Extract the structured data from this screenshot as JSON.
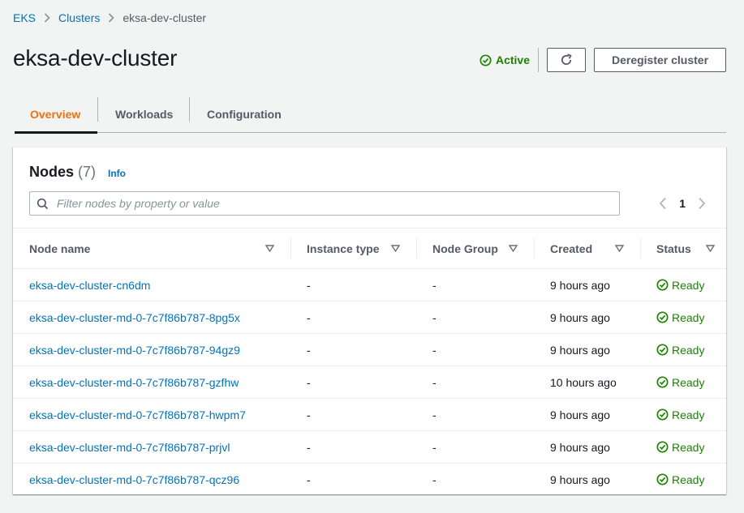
{
  "breadcrumb": {
    "items": [
      "EKS",
      "Clusters"
    ],
    "current": "eksa-dev-cluster"
  },
  "header": {
    "title": "eksa-dev-cluster",
    "status": "Active",
    "refresh_icon": "refresh-icon",
    "deregister_label": "Deregister cluster"
  },
  "tabs": [
    {
      "label": "Overview",
      "active": true
    },
    {
      "label": "Workloads",
      "active": false
    },
    {
      "label": "Configuration",
      "active": false
    }
  ],
  "nodes": {
    "title": "Nodes",
    "count": "(7)",
    "info_label": "Info",
    "filter_placeholder": "Filter nodes by property or value",
    "page": "1",
    "columns": [
      "Node name",
      "Instance type",
      "Node Group",
      "Created",
      "Status"
    ],
    "rows": [
      {
        "name": "eksa-dev-cluster-cn6dm",
        "instance_type": "-",
        "node_group": "-",
        "created": "9 hours ago",
        "status": "Ready"
      },
      {
        "name": "eksa-dev-cluster-md-0-7c7f86b787-8pg5x",
        "instance_type": "-",
        "node_group": "-",
        "created": "9 hours ago",
        "status": "Ready"
      },
      {
        "name": "eksa-dev-cluster-md-0-7c7f86b787-94gz9",
        "instance_type": "-",
        "node_group": "-",
        "created": "9 hours ago",
        "status": "Ready"
      },
      {
        "name": "eksa-dev-cluster-md-0-7c7f86b787-gzfhw",
        "instance_type": "-",
        "node_group": "-",
        "created": "10 hours ago",
        "status": "Ready"
      },
      {
        "name": "eksa-dev-cluster-md-0-7c7f86b787-hwpm7",
        "instance_type": "-",
        "node_group": "-",
        "created": "9 hours ago",
        "status": "Ready"
      },
      {
        "name": "eksa-dev-cluster-md-0-7c7f86b787-prjvl",
        "instance_type": "-",
        "node_group": "-",
        "created": "9 hours ago",
        "status": "Ready"
      },
      {
        "name": "eksa-dev-cluster-md-0-7c7f86b787-qcz96",
        "instance_type": "-",
        "node_group": "-",
        "created": "9 hours ago",
        "status": "Ready"
      }
    ]
  },
  "colors": {
    "link": "#0073bb",
    "success": "#1d8102",
    "active_tab": "#ec7211",
    "background": "#f2f3f3"
  }
}
